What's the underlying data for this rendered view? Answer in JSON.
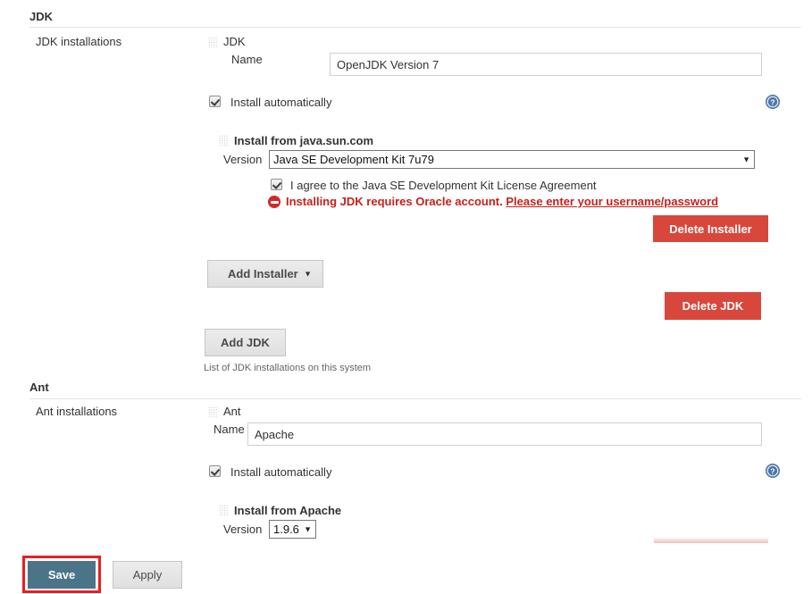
{
  "jdk": {
    "section_title": "JDK",
    "row_label": "JDK installations",
    "entry_title": "JDK",
    "name_label": "Name",
    "name_value": "OpenJDK Version 7",
    "install_automatically_label": "Install automatically",
    "installer_title": "Install from java.sun.com",
    "version_label": "Version",
    "version_value": "Java SE Development Kit 7u79",
    "license_label": "I agree to the Java SE Development Kit License Agreement",
    "error_text": "Installing JDK requires Oracle account.",
    "error_link": "Please enter your username/password",
    "delete_installer_label": "Delete Installer",
    "add_installer_label": "Add Installer",
    "delete_jdk_label": "Delete JDK",
    "add_jdk_label": "Add JDK",
    "hint": "List of JDK installations on this system",
    "help_icon": "help-icon",
    "drag_icon": "drag-handle-icon",
    "error_icon": "error-circle-icon",
    "dropdown_arrow": "▼"
  },
  "ant": {
    "section_title": "Ant",
    "row_label": "Ant installations",
    "entry_title": "Ant",
    "name_label": "Name",
    "name_value": "Apache",
    "install_automatically_label": "Install automatically",
    "installer_title": "Install from Apache",
    "version_label": "Version",
    "version_value": "1.9.6",
    "help_icon": "help-icon",
    "drag_icon": "drag-handle-icon",
    "dropdown_arrow": "▼"
  },
  "footer": {
    "save_label": "Save",
    "apply_label": "Apply"
  },
  "colors": {
    "danger": "#d8473b",
    "primary": "#4c7489",
    "error_text": "#c7201a",
    "annotation": "#ef1c1c",
    "help_blue": "#4a77a8"
  }
}
